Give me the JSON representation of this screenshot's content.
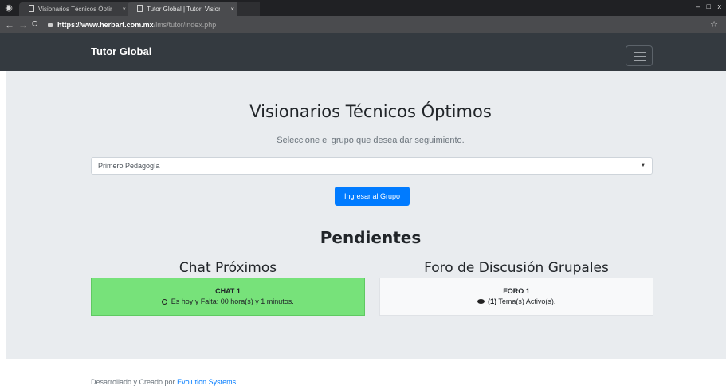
{
  "browser": {
    "tabs": [
      {
        "title": "Visionarios Técnicos Óptim",
        "close": "×"
      },
      {
        "title": "Tutor Global | Tutor: Vision",
        "close": "×"
      }
    ],
    "url_domain": "https://www.herbart.com.mx",
    "url_path": "/lms/tutor/index.php",
    "back": "←",
    "forward": "→",
    "reload": "C",
    "star": "☆",
    "window_controls": {
      "minimize": "–",
      "maximize": "□",
      "close": "x"
    },
    "chrome_color": "#4a4b4e"
  },
  "navbar": {
    "brand": "Tutor Global",
    "color": "#343a40"
  },
  "main": {
    "title": "Visionarios Técnicos Óptimos",
    "subtitle": "Seleccione el grupo que desea dar seguimiento.",
    "select_value": "Primero Pedagogía",
    "button_label": "Ingresar al Grupo",
    "button_color": "#007bff"
  },
  "pendientes": {
    "heading": "Pendientes",
    "chat": {
      "heading": "Chat Próximos",
      "title": "CHAT 1",
      "detail": "Es hoy y Falta: 00 hora(s) y 1 minutos.",
      "color": "#77e27a",
      "icon": "clock-icon"
    },
    "foro": {
      "heading": "Foro de Discusión Grupales",
      "title": "FORO 1",
      "count": "(1)",
      "detail": "Tema(s) Activo(s).",
      "icon": "comment-icon"
    }
  },
  "footer": {
    "text": "Desarrollado y Creado por ",
    "link": "Evolution Systems"
  }
}
